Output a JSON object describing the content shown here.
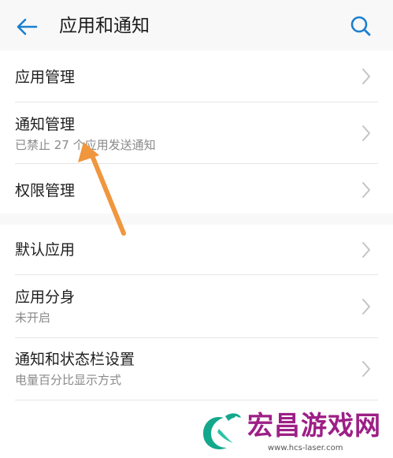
{
  "header": {
    "title": "应用和通知",
    "back_icon": "back-arrow-icon",
    "search_icon": "search-icon",
    "accent_color": "#1a7fd0"
  },
  "group1": [
    {
      "title": "应用管理",
      "subtitle": ""
    },
    {
      "title": "通知管理",
      "subtitle": "已禁止 27 个应用发送通知"
    },
    {
      "title": "权限管理",
      "subtitle": ""
    }
  ],
  "group2": [
    {
      "title": "默认应用",
      "subtitle": ""
    },
    {
      "title": "应用分身",
      "subtitle": "未开启"
    },
    {
      "title": "通知和状态栏设置",
      "subtitle": "电量百分比显示方式"
    }
  ],
  "annotation": {
    "color": "#f0963e",
    "points_to": "通知管理"
  },
  "watermark": {
    "brand": "宏昌游戏网",
    "url": "www.hcs-laser.com",
    "brand_color": "#9d1f86",
    "logo_color": "#13a88c"
  }
}
